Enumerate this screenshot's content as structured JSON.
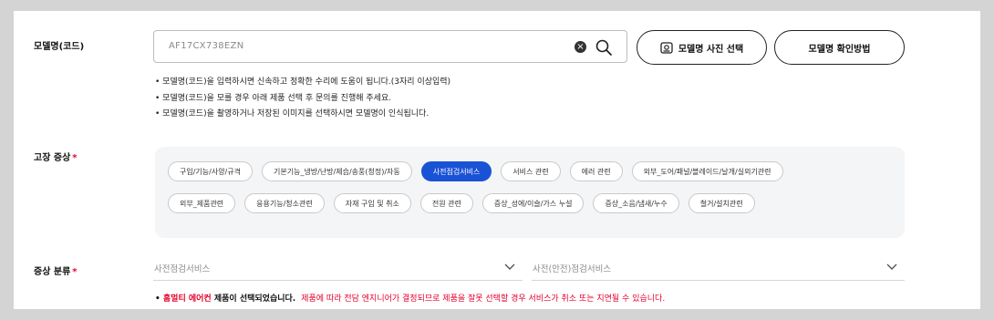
{
  "model": {
    "label": "모델명(코드)",
    "value": "AF17CX738EZN",
    "clear_icon": "close-circle-icon",
    "search_icon": "search-icon",
    "photo_button": "모델명 사진 선택",
    "howto_button": "모델명 확인방법",
    "notes": [
      "모델명(코드)을 입력하시면 신속하고 정확한 수리에 도움이 됩니다.(3자리 이상입력)",
      "모델명(코드)을 모를 경우 아래 제품 선택 후 문의를 진행해 주세요.",
      "모델명(코드)을 촬영하거나 저장된 이미지를 선택하시면 모델명이 인식됩니다."
    ]
  },
  "symptom": {
    "label": "고장 증상",
    "required_mark": "*",
    "chips_row1": [
      "구입/기능/사양/규격",
      "기본기능_냉방/난방/제습/송풍(청정)/자동",
      "사전점검서비스",
      "서비스 관련",
      "에러 관련",
      "외부_도어/패널/블레이드/날개/실외기관련"
    ],
    "chips_row2": [
      "외부_제품관련",
      "응용기능/청소관련",
      "자재 구입 및 취소",
      "전원 관련",
      "증상_성에/이슬/가스 누설",
      "증상_소음/냄새/누수",
      "철거/설치관련"
    ],
    "active_chip": "사전점검서비스",
    "active_color": "#1a52d6"
  },
  "classification": {
    "label": "증상 분류",
    "required_mark": "*",
    "select1": "사전점검서비스",
    "select2": "사전(안전)점검서비스"
  },
  "bottom_note": {
    "product": "홈멀티 에어컨",
    "selected": " 제품이 선택되었습니다.",
    "warning": "제품에 따라 전담 엔지니어가 결정되므로 제품을 잘못 선택할 경우 서비스가 취소 또는 지연될 수 있습니다."
  }
}
